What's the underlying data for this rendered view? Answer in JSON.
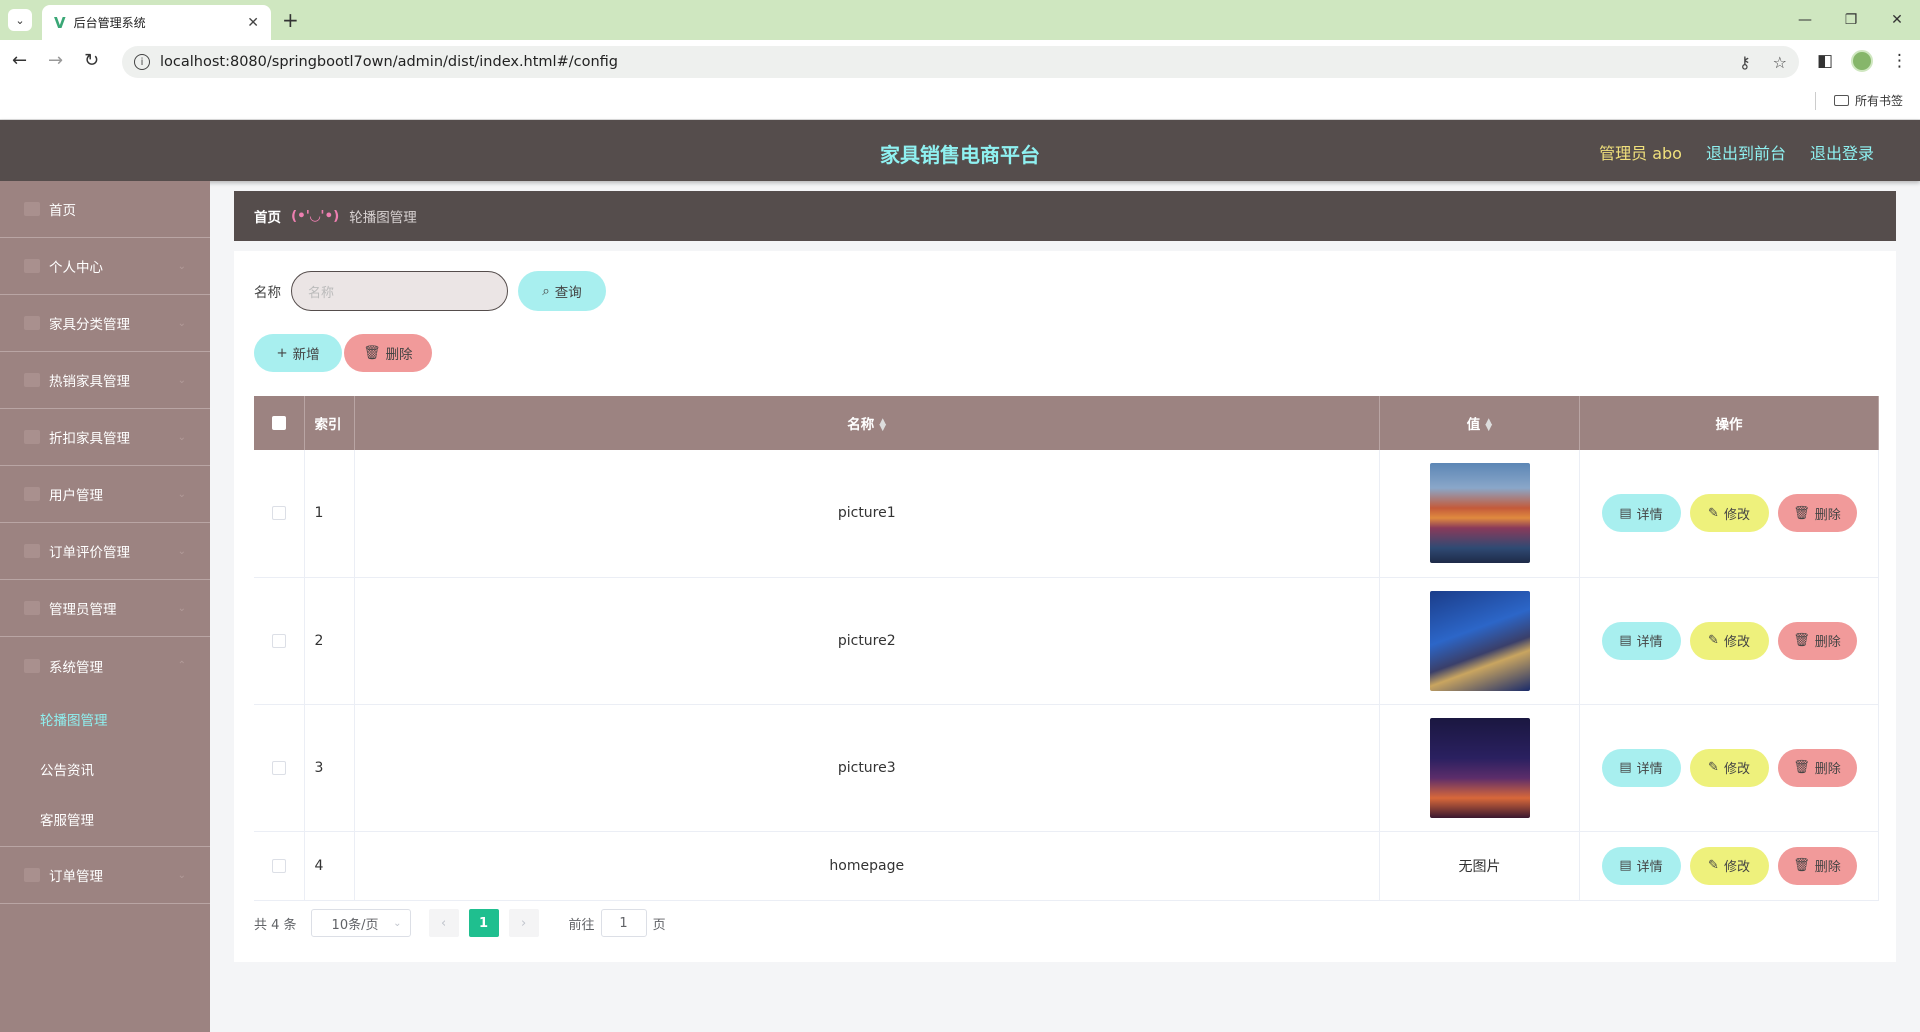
{
  "browser": {
    "tab_title": "后台管理系统",
    "url": "localhost:8080/springbootl7own/admin/dist/index.html#/config",
    "bookmarks_label": "所有书签"
  },
  "header": {
    "brand": "家具销售电商平台",
    "admin_label": "管理员 abo",
    "front_link": "退出到前台",
    "logout_link": "退出登录"
  },
  "sidebar": {
    "items": [
      {
        "label": "首页",
        "icon": "home-icon"
      },
      {
        "label": "个人中心",
        "icon": "user-icon"
      },
      {
        "label": "家具分类管理",
        "icon": "category-icon"
      },
      {
        "label": "热销家具管理",
        "icon": "hot-icon"
      },
      {
        "label": "折扣家具管理",
        "icon": "discount-icon"
      },
      {
        "label": "用户管理",
        "icon": "users-icon"
      },
      {
        "label": "订单评价管理",
        "icon": "comment-icon"
      },
      {
        "label": "管理员管理",
        "icon": "admin-icon"
      },
      {
        "label": "系统管理",
        "icon": "system-icon"
      }
    ],
    "system_sub": [
      "轮播图管理",
      "公告资讯",
      "客服管理"
    ],
    "order_item": "订单管理"
  },
  "breadcrumb": {
    "home": "首页",
    "face": "(•'◡'•)",
    "current": "轮播图管理"
  },
  "search": {
    "label": "名称",
    "placeholder": "名称",
    "button": "查询"
  },
  "actions": {
    "add": "新增",
    "delete": "删除"
  },
  "table": {
    "headers": {
      "index": "索引",
      "name": "名称",
      "value": "值",
      "ops": "操作"
    },
    "rows": [
      {
        "index": "1",
        "name": "picture1",
        "value": "",
        "has_image": true
      },
      {
        "index": "2",
        "name": "picture2",
        "value": "",
        "has_image": true
      },
      {
        "index": "3",
        "name": "picture3",
        "value": "",
        "has_image": true
      },
      {
        "index": "4",
        "name": "homepage",
        "value": "无图片",
        "has_image": false
      }
    ],
    "row_buttons": {
      "detail": "详情",
      "edit": "修改",
      "delete": "删除"
    }
  },
  "pagination": {
    "total": "共 4 条",
    "page_size": "10条/页",
    "current_page": "1",
    "goto_label": "前往",
    "goto_value": "1",
    "page_suffix": "页"
  },
  "colors": {
    "header_bg": "#554d4c",
    "sidebar_bg": "#9c8381",
    "accent_cyan": "#8ff1f1",
    "button_cyan": "#a8efef",
    "button_red": "#f19a9a",
    "button_yellow": "#eef17c",
    "page_active": "#1fbf8f"
  }
}
